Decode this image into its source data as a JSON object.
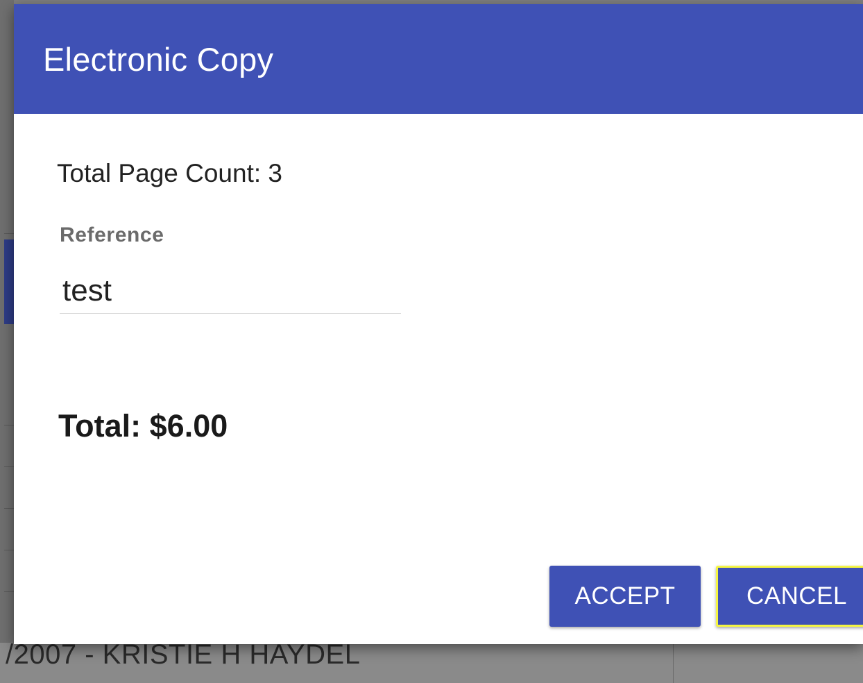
{
  "dialog": {
    "title": "Electronic Copy",
    "page_count_text": "Total Page Count: 3",
    "reference": {
      "label": "Reference",
      "value": "test"
    },
    "total_text": "Total: $6.00",
    "buttons": {
      "accept_label": "ACCEPT",
      "cancel_label": "CANCEL"
    }
  },
  "background": {
    "visible_row_text": "/2007 - KRISTIE H HAYDEL"
  },
  "colors": {
    "header": "#3f51b5",
    "button": "#3f51b5",
    "focus_outline": "#f5f543"
  }
}
